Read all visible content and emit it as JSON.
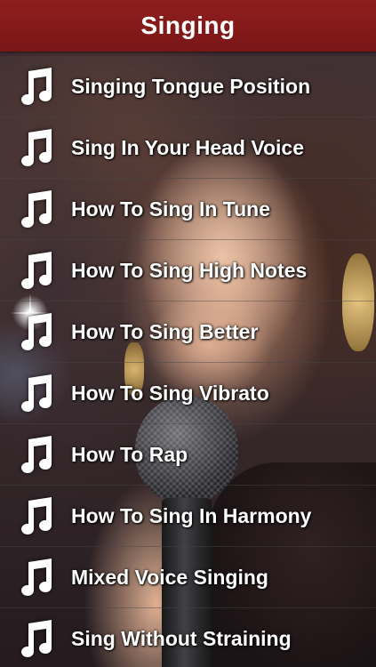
{
  "header": {
    "title": "Singing"
  },
  "theme": {
    "header_color": "#8f1e1e",
    "text_color": "#ffffff"
  },
  "list_icon": "music-note-icon",
  "items": [
    {
      "label": "Singing Tongue Position"
    },
    {
      "label": "Sing In Your Head Voice"
    },
    {
      "label": "How To Sing In Tune"
    },
    {
      "label": "How To Sing High Notes"
    },
    {
      "label": "How To Sing Better"
    },
    {
      "label": "How To Sing Vibrato"
    },
    {
      "label": "How To Rap"
    },
    {
      "label": "How To Sing In Harmony"
    },
    {
      "label": "Mixed Voice Singing"
    },
    {
      "label": "Sing Without Straining"
    }
  ]
}
